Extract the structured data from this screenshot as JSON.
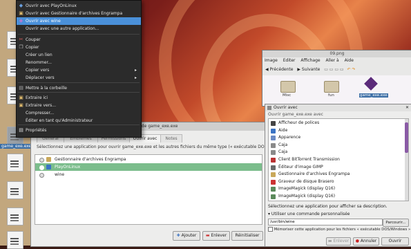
{
  "desktop": {
    "selected_icon_label": "game_exe.exe"
  },
  "context_menu": {
    "items": [
      {
        "label": "Ouvrir avec PlayOnLinux",
        "icon": "playonlinux-icon",
        "submenu": false
      },
      {
        "label": "Ouvrir avec Gestionnaire d'archives Engrampa",
        "icon": "archive-icon",
        "submenu": false
      },
      {
        "label": "Ouvrir avec wine",
        "icon": "wine-icon",
        "submenu": false
      },
      {
        "label": "Ouvrir avec une autre application...",
        "icon": "",
        "submenu": false
      },
      {
        "label": "Couper",
        "icon": "cut-icon",
        "submenu": false
      },
      {
        "label": "Copier",
        "icon": "copy-icon",
        "submenu": false
      },
      {
        "label": "Créer un lien",
        "icon": "",
        "submenu": false
      },
      {
        "label": "Renommer...",
        "icon": "",
        "submenu": false
      },
      {
        "label": "Copier vers",
        "icon": "",
        "submenu": true
      },
      {
        "label": "Déplacer vers",
        "icon": "",
        "submenu": true
      },
      {
        "label": "Mettre à la corbeille",
        "icon": "trash-icon",
        "submenu": false
      },
      {
        "label": "Extraire ici",
        "icon": "extract-icon",
        "submenu": false
      },
      {
        "label": "Extraire vers...",
        "icon": "extract-icon",
        "submenu": false
      },
      {
        "label": "Compresser...",
        "icon": "",
        "submenu": false
      },
      {
        "label": "Éditer en tant qu'Administrateur",
        "icon": "",
        "submenu": false
      },
      {
        "label": "Propriétés",
        "icon": "properties-icon",
        "submenu": false
      }
    ]
  },
  "file_manager": {
    "title": "09.png",
    "menu": [
      "Image",
      "Editer",
      "Affichage",
      "Aller à",
      "Aide"
    ],
    "back_label": "Précédente",
    "forward_label": "Suivante",
    "files": [
      "Misc",
      "fun",
      "game_exe.exe"
    ]
  },
  "properties_dialog": {
    "title": "Propriétés de game_exe.exe",
    "tabs": [
      "Général",
      "Emblèmes",
      "Permissions",
      "Ouvrir avec",
      "Notes"
    ],
    "active_tab": "Ouvrir avec",
    "description": "Sélectionnez une application pour ouvrir game_exe.exe et les autres fichiers du même type (« exécutable DOS/Windows »)",
    "apps": [
      {
        "name": "Gestionnaire d'archives Engrampa"
      },
      {
        "name": "PlayOnLinux"
      },
      {
        "name": "wine"
      }
    ],
    "buttons": {
      "add": "Ajouter",
      "remove": "Enlever",
      "reset": "Réinitialiser"
    }
  },
  "open_with_dialog": {
    "title": "Ouvrir avec",
    "subtitle": "Ouvrir game_exe.exe avec",
    "apps": [
      "Afficheur de polices",
      "Aide",
      "Apparence",
      "Caja",
      "Caja",
      "Client BitTorrent Transmission",
      "Éditeur d'image GIMP",
      "Gestionnaire d'archives Engrampa",
      "Graveur de disque Brasero",
      "ImageMagick (display Q16)",
      "ImageMagick (display Q16)"
    ],
    "hint": "Sélectionnez une application pour afficher sa description.",
    "custom_command_label": "Utiliser une commande personnalisée",
    "command_value": "/usr/bin/wine",
    "browse_label": "Parcourir...",
    "remember_label": "Mémoriser cette application pour les fichiers « exécutable DOS/Windows »",
    "buttons": {
      "remove": "Enlever",
      "cancel": "Annuler",
      "open": "Ouvrir"
    }
  }
}
